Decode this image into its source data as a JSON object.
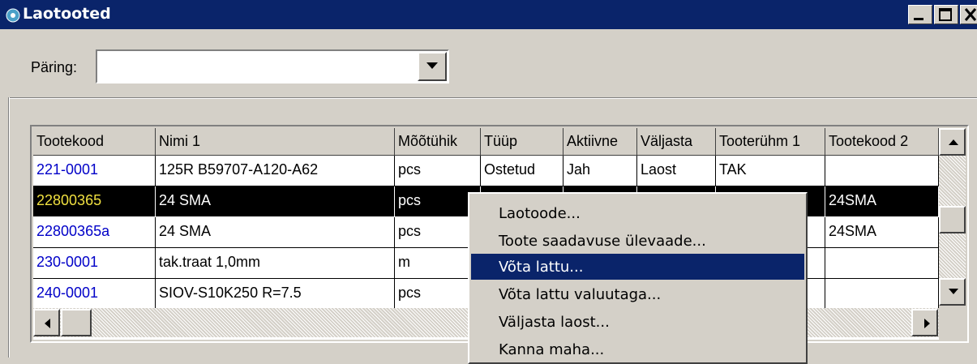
{
  "window": {
    "title": "Laotooted"
  },
  "query": {
    "label": "Päring:",
    "value": ""
  },
  "table": {
    "columns": [
      "Tootekood",
      "Nimi 1",
      "Mõõtühik",
      "Tüüp",
      "Aktiivne",
      "Väljasta",
      "Tooterühm 1",
      "Tootekood 2"
    ],
    "rows": [
      [
        "221-0001",
        "125R B59707-A120-A62",
        "pcs",
        "Ostetud",
        "Jah",
        "Laost",
        "TAK",
        ""
      ],
      [
        "22800365",
        "24 SMA",
        "pcs",
        "",
        "",
        "",
        "",
        "24SMA"
      ],
      [
        "22800365a",
        "24 SMA",
        "pcs",
        "",
        "",
        "",
        "",
        "24SMA"
      ],
      [
        "230-0001",
        "tak.traat 1,0mm",
        "m",
        "",
        "",
        "",
        "",
        ""
      ],
      [
        "240-0001",
        "SIOV-S10K250 R=7.5",
        "pcs",
        "",
        "",
        "",
        "",
        ""
      ]
    ],
    "selected_row": 1
  },
  "context_menu": {
    "items": [
      "Laotoode...",
      "Toote saadavuse ülevaade...",
      "Võta lattu...",
      "Võta lattu valuutaga...",
      "Väljasta laost...",
      "Kanna maha..."
    ],
    "highlighted": 2
  },
  "colors": {
    "title_bar": "#0a246a",
    "link_code": "#0000c8",
    "selected_code": "#f0e040"
  }
}
